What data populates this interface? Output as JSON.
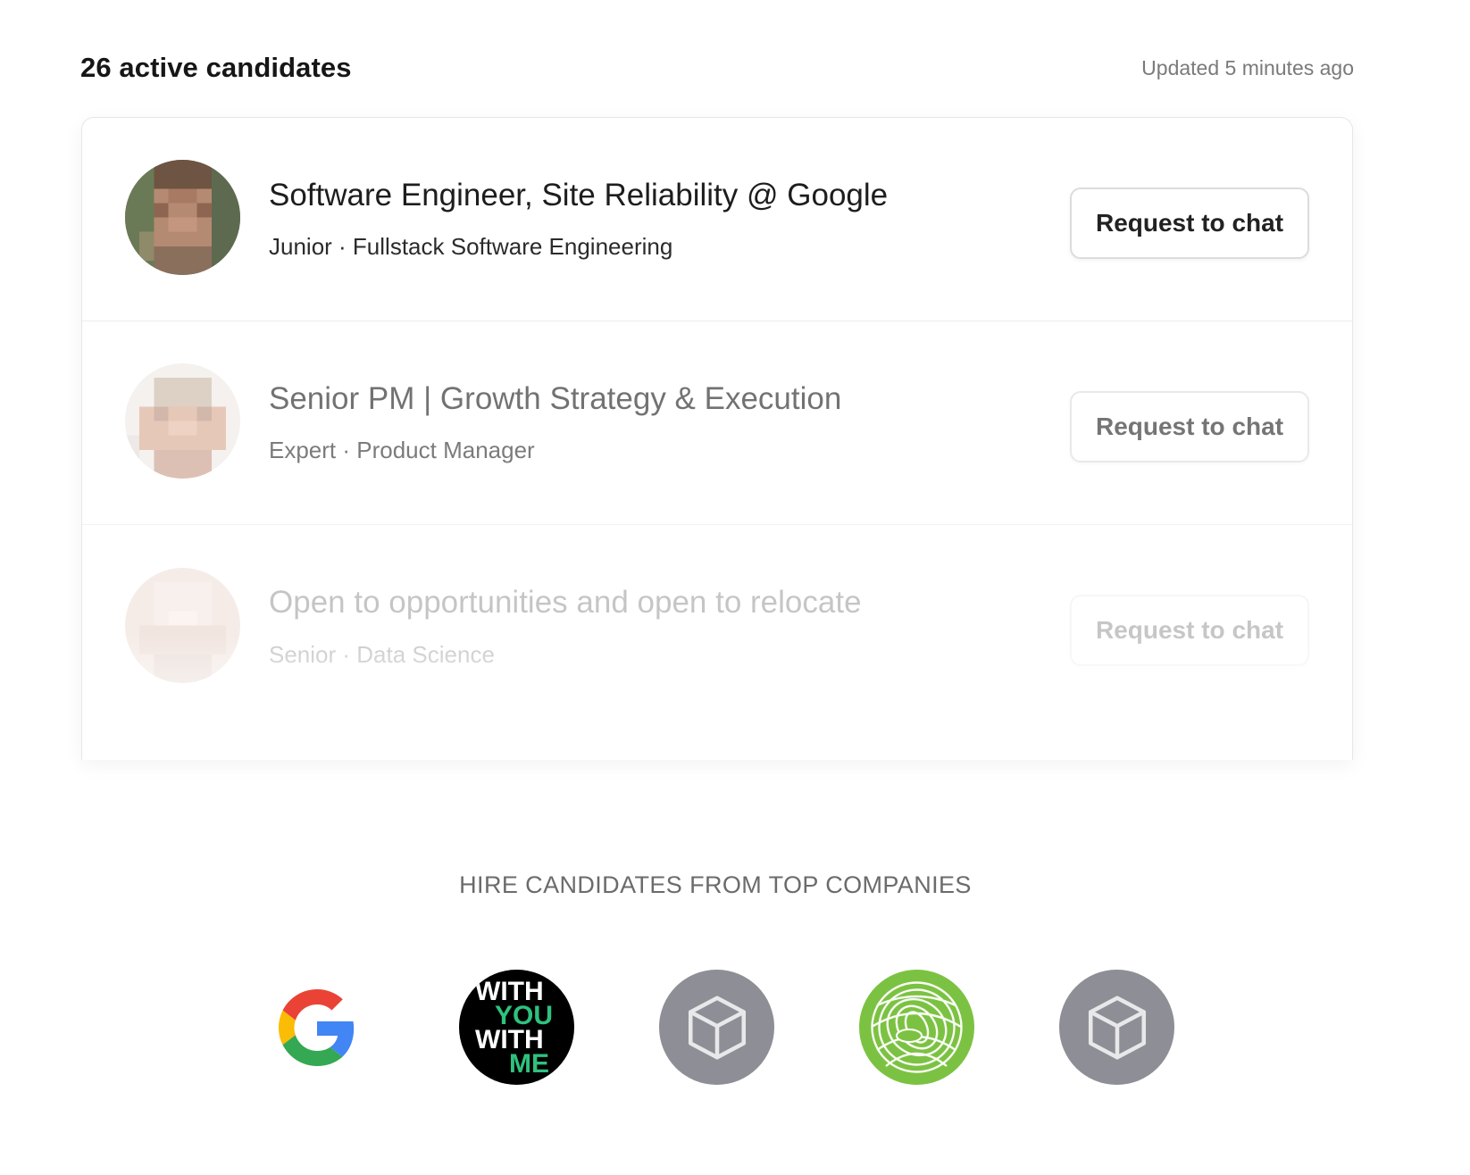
{
  "header": {
    "title": "26 active candidates",
    "updated": "Updated 5 minutes ago"
  },
  "candidates": [
    {
      "title": "Software Engineer, Site Reliability @ Google",
      "subtitle": "Junior · Fullstack Software Engineering",
      "button": "Request to chat"
    },
    {
      "title": "Senior PM | Growth Strategy & Execution",
      "subtitle": "Expert · Product Manager",
      "button": "Request to chat"
    },
    {
      "title": "Open to opportunities and open to relocate",
      "subtitle": "Senior · Data Science",
      "button": "Request to chat"
    }
  ],
  "companies": {
    "heading": "HIRE CANDIDATES FROM TOP COMPANIES",
    "logos": [
      {
        "icon": "google-logo-icon"
      },
      {
        "icon": "with-you-with-me-logo-icon",
        "text": [
          "WITH",
          "YOU",
          "WITH",
          "ME"
        ],
        "colors": [
          "#ffffff",
          "#2ec27e",
          "#ffffff",
          "#2ec27e"
        ]
      },
      {
        "icon": "placeholder-box-icon"
      },
      {
        "icon": "green-swirl-logo-icon"
      },
      {
        "icon": "placeholder-box-icon"
      }
    ]
  },
  "colors": {
    "accent_green": "#7cc242",
    "placeholder_gray": "#8e8e96"
  }
}
